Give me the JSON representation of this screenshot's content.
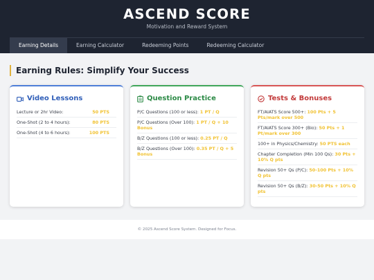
{
  "header": {
    "title": "ASCEND SCORE",
    "subtitle": "Motivation and Reward System"
  },
  "tabs": [
    {
      "label": "Earning Details",
      "active": true
    },
    {
      "label": "Earning Calculator",
      "active": false
    },
    {
      "label": "Redeeming Points",
      "active": false
    },
    {
      "label": "Redeeming Calculator",
      "active": false
    }
  ],
  "section": {
    "title": "Earning Rules: Simplify Your Success",
    "accent_color": "#e0b23d"
  },
  "cards": [
    {
      "title": "Video Lessons",
      "icon": "video-camera-icon",
      "color": "#2f5eb8",
      "rows": [
        {
          "label": "Lecture or 2hr Video:",
          "points": "50 PTS"
        },
        {
          "label": "One-Shot (2 to 4 hours):",
          "points": "80 PTS"
        },
        {
          "label": "One-Shot (4 to 6 hours):",
          "points": "100 PTS"
        }
      ]
    },
    {
      "title": "Question Practice",
      "icon": "clipboard-icon",
      "color": "#2c8a46",
      "rows": [
        {
          "label": "P/C Questions (100 or less):",
          "points": "1 PT / Q"
        },
        {
          "label": "P/C Questions (Over 100):",
          "points": "1 PT / Q + 10 Bonus"
        },
        {
          "label": "B/Z Questions (100 or less):",
          "points": "0.25 PT / Q"
        },
        {
          "label": "B/Z Questions (Over 100):",
          "points": "0.35 PT / Q + 5 Bonus"
        }
      ]
    },
    {
      "title": "Tests & Bonuses",
      "icon": "check-circle-icon",
      "color": "#c23a3a",
      "rows": [
        {
          "label": "FT/AIATS Score 500+:",
          "points": "100 Pts + 5 Pts/mark over 500"
        },
        {
          "label": "FT/AIATS Score 300+ (Bio):",
          "points": "50 Pts + 1 Pt/mark over 300"
        },
        {
          "label": "100+ in Physics/Chemistry:",
          "points": "50 PTS each"
        },
        {
          "label": "Chapter Completion (Min 100 Qs):",
          "points": "30 Pts + 10% Q pts"
        },
        {
          "label": "Revision 50+ Qs (P/C):",
          "points": "50-100 Pts + 10% Q pts"
        },
        {
          "label": "Revision 50+ Qs (B/Z):",
          "points": "30-50 Pts + 10% Q pts"
        }
      ]
    }
  ],
  "colors": {
    "header_bg": "#1e2431",
    "points": "#f1c232"
  },
  "footer": {
    "text": "© 2025 Ascend Score System. Designed for Focus."
  }
}
